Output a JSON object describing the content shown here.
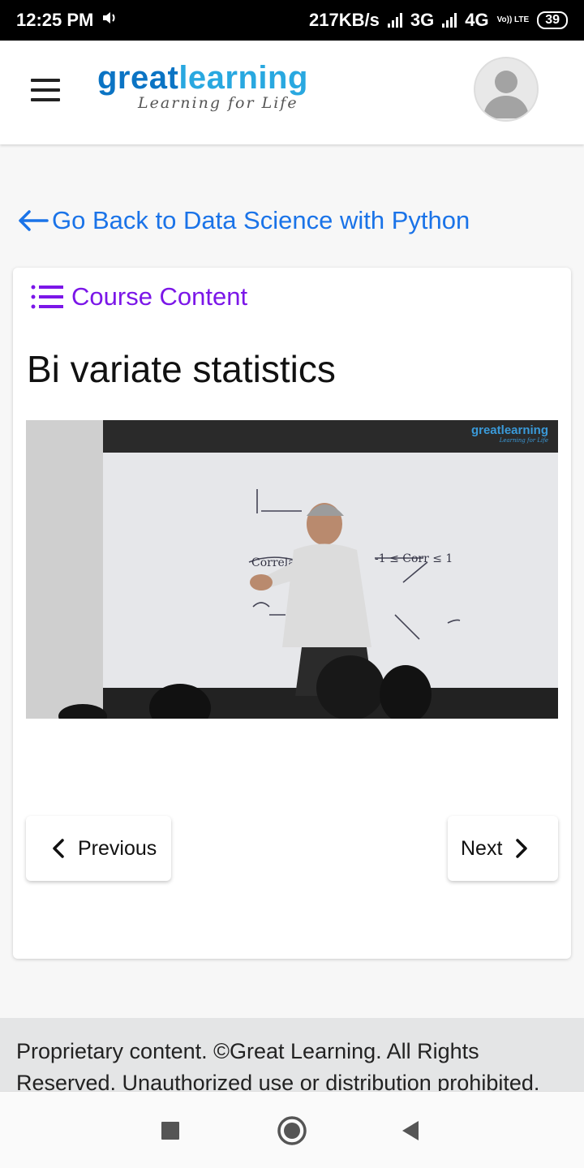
{
  "status_bar": {
    "time": "12:25 PM",
    "speed": "217KB/s",
    "net1": "3G",
    "net2": "4G",
    "volte": "Vo)) LTE",
    "battery": "39"
  },
  "header": {
    "logo_part1": "great",
    "logo_part2": "learning",
    "logo_tagline": "Learning for Life",
    "menu_icon": "hamburger-menu-icon",
    "avatar_icon": "user-avatar-icon"
  },
  "back_link": {
    "label": "Go Back to Data Science with Python",
    "icon": "arrow-left-icon"
  },
  "card": {
    "course_content_label": "Course Content",
    "course_content_icon": "list-icon",
    "lesson_title": "Bi variate statistics",
    "video": {
      "watermark_main": "greatlearning",
      "watermark_tag": "Learning for Life"
    },
    "previous_label": "Previous",
    "next_label": "Next"
  },
  "footer": {
    "text": "Proprietary content. ©Great Learning. All Rights Reserved. Unauthorized use or distribution prohibited."
  },
  "colors": {
    "link_blue": "#1a73e8",
    "course_purple": "#7b16e8",
    "logo_dark_blue": "#0b74c4",
    "logo_light_blue": "#29a8e0"
  }
}
